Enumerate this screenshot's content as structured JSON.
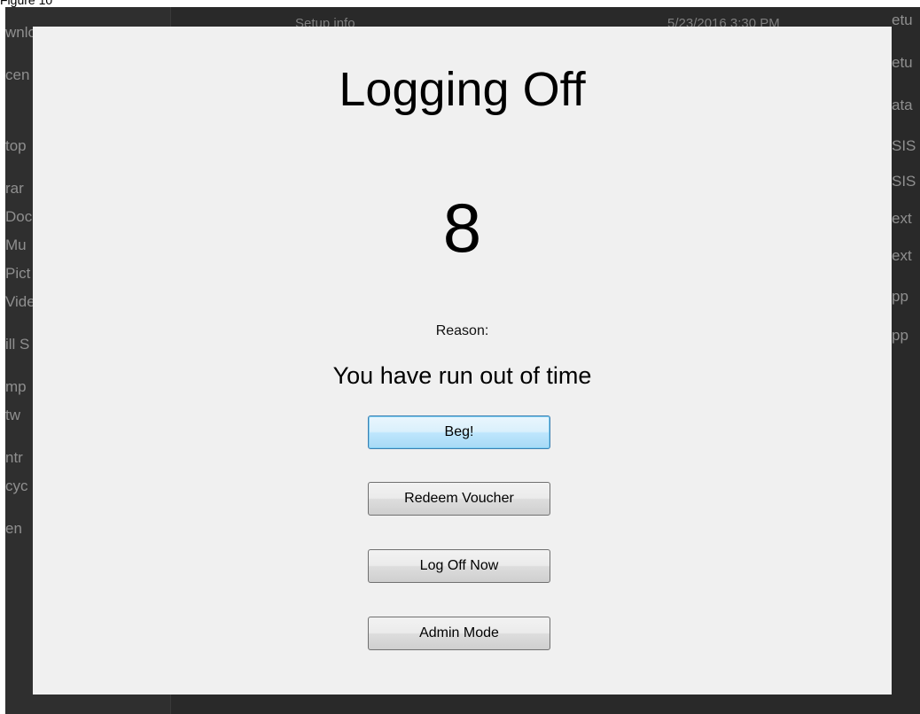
{
  "figure_caption": "Figure 10",
  "background": {
    "nav_items": [
      "wnload",
      "cen",
      "",
      "top",
      "rar",
      "Doc",
      "Mu",
      "Pict",
      "Vide",
      "ill S",
      "mp",
      "tw",
      "ntr",
      "cyc",
      "en"
    ],
    "top_row": {
      "name": "Setup info",
      "date": "5/23/2016 3:30 PM"
    },
    "right_items": [
      "etu",
      "etu",
      "ata",
      "SIS",
      "SIS",
      "ext",
      "ext",
      "pp",
      "pp"
    ]
  },
  "dialog": {
    "title": "Logging Off",
    "countdown": "8",
    "reason_label": "Reason:",
    "reason_text": "You have run out of time",
    "buttons": {
      "beg": "Beg!",
      "redeem": "Redeem Voucher",
      "log_off": "Log Off Now",
      "admin": "Admin Mode"
    }
  }
}
